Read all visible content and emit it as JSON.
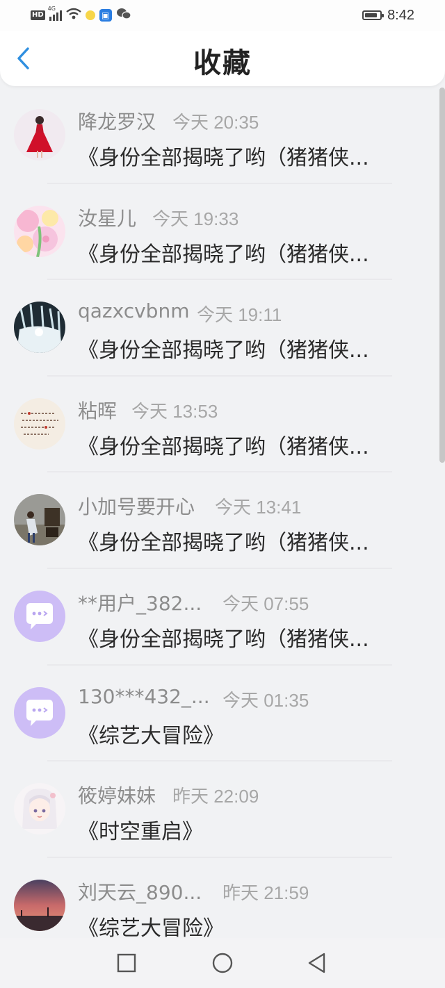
{
  "status_bar": {
    "hd": "HD",
    "network": "4G",
    "time": "8:42",
    "battery_level": 0.85
  },
  "header": {
    "title": "收藏",
    "back_icon": "chevron-left-icon",
    "accent": "#2f8fe0"
  },
  "items": [
    {
      "name": "降龙罗汉",
      "time": "今天 20:35",
      "content": "《身份全部揭晓了哟（猪猪侠...",
      "avatar": "photo-red-dress"
    },
    {
      "name": "汝星儿",
      "time": "今天 19:33",
      "content": "《身份全部揭晓了哟（猪猪侠...",
      "avatar": "photo-pink-flowers"
    },
    {
      "name": "qazxcvbnm",
      "time": "今天 19:11",
      "content": "《身份全部揭晓了哟（猪猪侠...",
      "avatar": "photo-ice"
    },
    {
      "name": "粘晖",
      "time": "今天 13:53",
      "content": "《身份全部揭晓了哟（猪猪侠...",
      "avatar": "photo-handwriting"
    },
    {
      "name": "小加号要开心",
      "time": "今天 13:41",
      "content": "《身份全部揭晓了哟（猪猪侠...",
      "avatar": "photo-room"
    },
    {
      "name": "**用户_382...",
      "time": "今天 07:55",
      "content": "《身份全部揭晓了哟（猪猪侠...",
      "avatar": "default-chat-bubble"
    },
    {
      "name": "130***432_...",
      "time": "今天 01:35",
      "content": "《综艺大冒险》",
      "avatar": "default-chat-bubble"
    },
    {
      "name": "筱婷妹妹",
      "time": "昨天 22:09",
      "content": "《时空重启》",
      "avatar": "photo-anime-girl"
    },
    {
      "name": "刘天云_890...",
      "time": "昨天 21:59",
      "content": "《综艺大冒险》",
      "avatar": "photo-sunset"
    }
  ],
  "nav": {
    "recent_icon": "square-icon",
    "home_icon": "circle-icon",
    "back_icon": "triangle-back-icon"
  }
}
